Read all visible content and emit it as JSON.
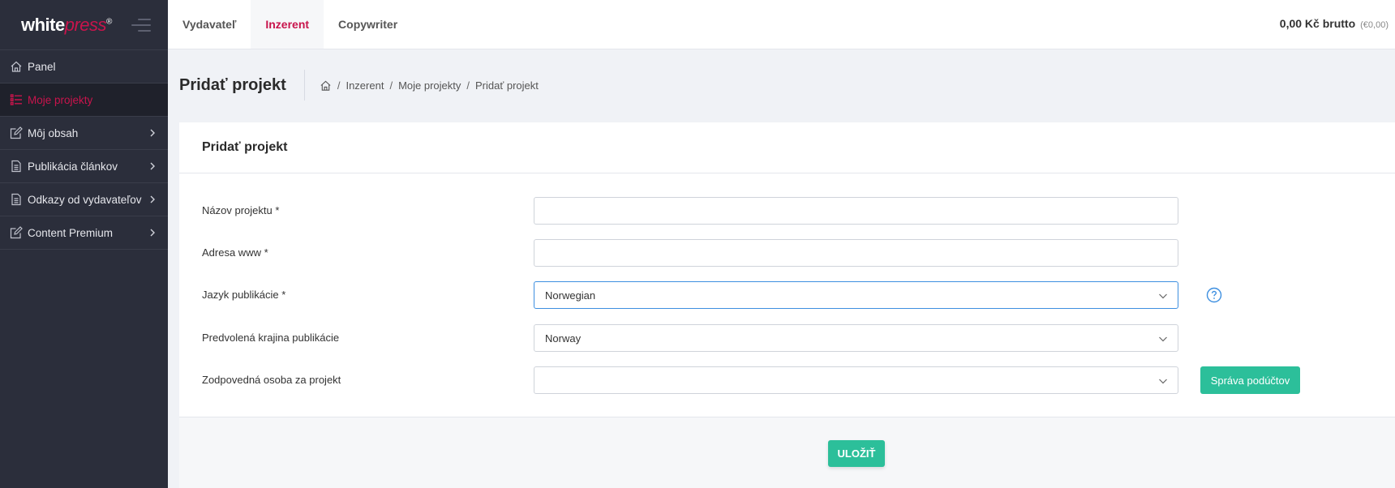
{
  "app": {
    "logo_white": "white",
    "logo_press": "press",
    "logo_reg": "®"
  },
  "sidebar": {
    "items": [
      {
        "label": "Panel",
        "icon": "home-icon"
      },
      {
        "label": "Moje projekty",
        "icon": "list-icon",
        "active": true
      },
      {
        "label": "Môj obsah",
        "icon": "edit-icon"
      },
      {
        "label": "Publikácia článkov",
        "icon": "document-icon"
      },
      {
        "label": "Odkazy od vydavateľov",
        "icon": "document-icon"
      },
      {
        "label": "Content Premium",
        "icon": "edit-icon"
      }
    ]
  },
  "topbar": {
    "tabs": [
      {
        "label": "Vydavateľ"
      },
      {
        "label": "Inzerent",
        "active": true
      },
      {
        "label": "Copywriter"
      }
    ],
    "balance": "0,00 Kč brutto",
    "balance_eur": "(€0,00)"
  },
  "page": {
    "title": "Pridať projekt",
    "breadcrumb": [
      "Inzerent",
      "Moje projekty",
      "Pridať projekt"
    ]
  },
  "form": {
    "title": "Pridať projekt",
    "fields": {
      "name_label": "Názov projektu *",
      "name_value": "",
      "url_label": "Adresa www *",
      "url_value": "",
      "language_label": "Jazyk publikácie *",
      "language_value": "Norwegian",
      "country_label": "Predvolená krajina publikácie",
      "country_value": "Norway",
      "person_label": "Zodpovedná osoba za projekt",
      "person_value": ""
    },
    "manage_button": "Správa podúčtov",
    "save_button": "ULOŽIŤ"
  },
  "colors": {
    "accent": "#c8144c",
    "green": "#2cbf9a",
    "sidebar_bg": "#2b2e3b",
    "focus": "#3d8fe0"
  }
}
